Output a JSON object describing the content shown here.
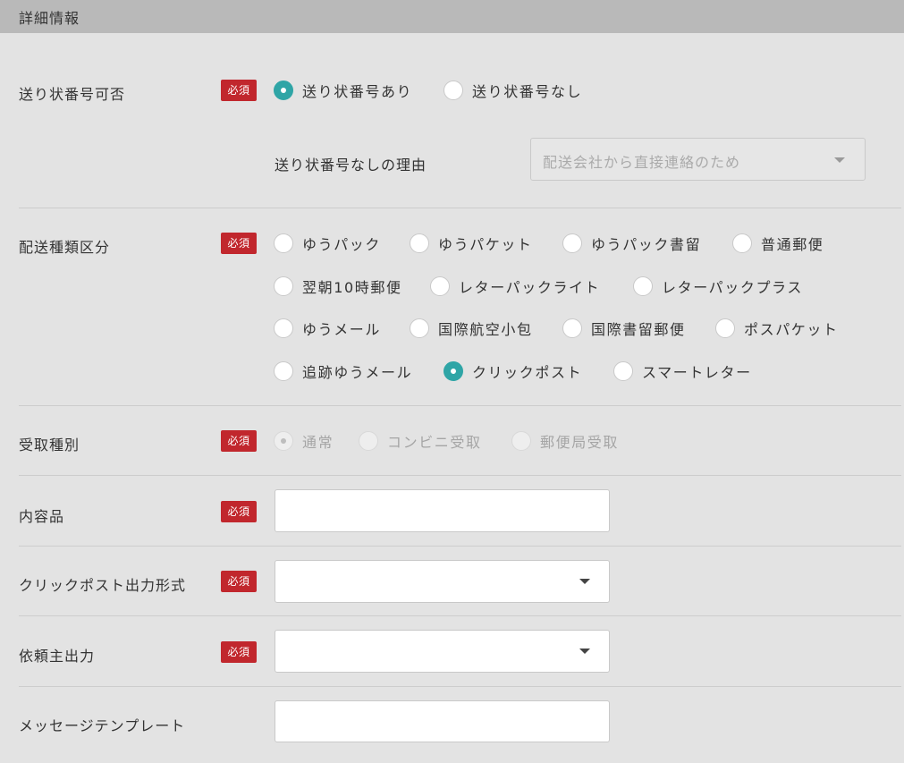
{
  "section": {
    "title": "詳細情報"
  },
  "required_label": "必須",
  "tracking": {
    "label": "送り状番号可否",
    "options": [
      {
        "label": "送り状番号あり",
        "checked": true
      },
      {
        "label": "送り状番号なし",
        "checked": false
      }
    ],
    "reason_label": "送り状番号なしの理由",
    "reason_select": {
      "value": "配送会社から直接連絡のため",
      "disabled": true
    }
  },
  "shipping_type": {
    "label": "配送種類区分",
    "options": [
      {
        "label": "ゆうパック",
        "checked": false
      },
      {
        "label": "ゆうパケット",
        "checked": false
      },
      {
        "label": "ゆうパック書留",
        "checked": false
      },
      {
        "label": "普通郵便",
        "checked": false
      },
      {
        "label": "翌朝10時郵便",
        "checked": false
      },
      {
        "label": "レターパックライト",
        "checked": false
      },
      {
        "label": "レターパックプラス",
        "checked": false
      },
      {
        "label": "ゆうメール",
        "checked": false
      },
      {
        "label": "国際航空小包",
        "checked": false
      },
      {
        "label": "国際書留郵便",
        "checked": false
      },
      {
        "label": "ポスパケット",
        "checked": false
      },
      {
        "label": "追跡ゆうメール",
        "checked": false
      },
      {
        "label": "クリックポスト",
        "checked": true
      },
      {
        "label": "スマートレター",
        "checked": false
      }
    ]
  },
  "receipt_type": {
    "label": "受取種別",
    "disabled": true,
    "options": [
      {
        "label": "通常",
        "checked": true
      },
      {
        "label": "コンビニ受取",
        "checked": false
      },
      {
        "label": "郵便局受取",
        "checked": false
      }
    ]
  },
  "contents": {
    "label": "内容品",
    "value": ""
  },
  "clickpost_format": {
    "label": "クリックポスト出力形式",
    "value": ""
  },
  "sender_output": {
    "label": "依頼主出力",
    "value": ""
  },
  "message_template": {
    "label": "メッセージテンプレート",
    "value": ""
  },
  "colors": {
    "accent": "#2fa5a6",
    "required_badge": "#c1272d",
    "header_bg": "#b9b9b9",
    "page_bg": "#e3e3e3"
  }
}
